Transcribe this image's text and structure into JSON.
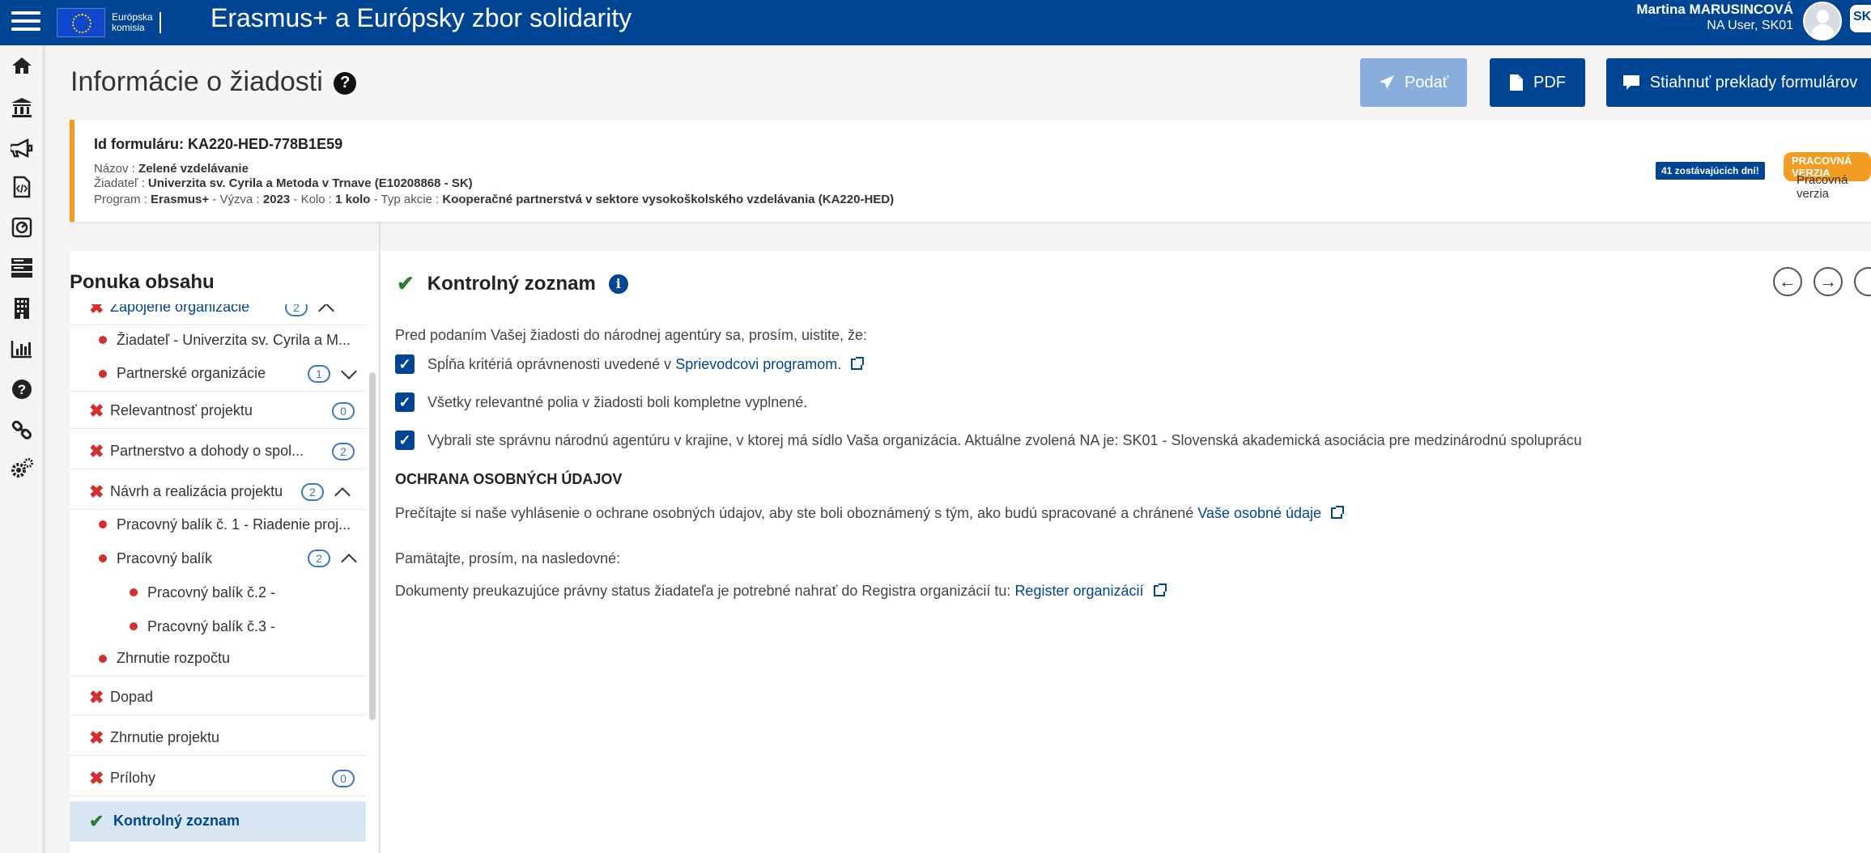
{
  "app": {
    "title": "Erasmus+ a Európsky zbor solidarity",
    "eu_logo_line1": "Európska",
    "eu_logo_line2": "komisia"
  },
  "user": {
    "name": "Martina MARUSINCOVÁ",
    "role": "NA User, SK01",
    "lang": "SK"
  },
  "rail": {
    "icons": [
      "home-icon",
      "institution-icon",
      "bullhorn-icon",
      "code-file-icon",
      "compass-icon",
      "server-icon",
      "building-icon",
      "bar-chart-icon",
      "question-icon",
      "link-icon",
      "cogs-icon"
    ]
  },
  "header": {
    "title": "Informácie o žiadosti",
    "help": "?",
    "submit_label": "Podať",
    "pdf_label": "PDF",
    "translate_label": "Stiahnuť preklady formulárov"
  },
  "form_info": {
    "id_label": "Id formuláru: KA220-HED-778B1E59",
    "name_prefix": "Názov : ",
    "name_value": "Zelené vzdelávanie",
    "applicant_prefix": "Žiadateľ : ",
    "applicant_value": "Univerzita sv. Cyrila a Metoda v Trnave (E10208868 - SK)",
    "program_prefix": "Program : ",
    "program_value": "Erasmus+",
    "call_prefix": " - Výzva : ",
    "call_value": "2023",
    "round_prefix": " - Kolo : ",
    "round_value": "1 kolo",
    "action_prefix": " - Typ akcie : ",
    "action_value": "Kooperačné partnerstvá v sektore vysokoškolského vzdelávania (KA220-HED)",
    "days_left": "41 zostávajúcich dní!",
    "version_badge": "PRACOVNÁ VERZIA",
    "version_text": "Pracovná verzia"
  },
  "toc": {
    "title": "Ponuka obsahu",
    "items": [
      {
        "label": "Zapojené organizácie",
        "count": "2"
      },
      {
        "label": "Žiadateľ - Univerzita sv. Cyrila a M..."
      },
      {
        "label": "Partnerské organizácie",
        "count": "1"
      },
      {
        "label": "Relevantnosť projektu",
        "count": "0"
      },
      {
        "label": "Partnerstvo a dohody o spol...",
        "count": "2"
      },
      {
        "label": "Návrh a realizácia projektu",
        "count": "2"
      },
      {
        "label": "Pracovný balík č. 1 - Riadenie proj..."
      },
      {
        "label": "Pracovný balík",
        "count": "2"
      },
      {
        "label": "Pracovný balík č.2 -"
      },
      {
        "label": "Pracovný balík č.3 -"
      },
      {
        "label": "Zhrnutie rozpočtu"
      },
      {
        "label": "Dopad"
      },
      {
        "label": "Zhrnutie projektu"
      },
      {
        "label": "Prílohy",
        "count": "0"
      },
      {
        "label": "Kontrolný zoznam"
      }
    ]
  },
  "main": {
    "title": "Kontrolný zoznam",
    "intro": "Pred podaním Vašej žiadosti do národnej agentúry sa, prosím, uistite, že:",
    "check1_text": "Spĺňa kritériá oprávnenosti uvedené v ",
    "check1_link": "Sprievodcovi programom.",
    "check2_text": "Všetky relevantné polia v žiadosti boli kompletne vyplnené.",
    "check3_text": "Vybrali ste správnu národnú agentúru v krajine, v ktorej má sídlo Vaša organizácia. Aktuálne zvolená NA je: SK01 - Slovenská akademická asociácia pre medzinárodnú spoluprácu",
    "gdpr_heading": "OCHRANA OSOBNÝCH ÚDAJOV",
    "gdpr_text": "Prečítajte si naše vyhlásenie o ochrane osobných údajov, aby ste boli oboznámený s tým, ako budú spracované a chránené ",
    "gdpr_link": "Vaše osobné údaje",
    "remember": "Pamätajte, prosím, na nasledovné:",
    "docs_text": "Dokumenty preukazujúce právny status žiadateľa je potrebné nahrať do Registra organizácií tu: ",
    "docs_link": "Register organizácií"
  },
  "colors": {
    "brand": "#004494",
    "warning": "#f29d21",
    "error": "#d32f2f",
    "success": "#2e7d32"
  }
}
